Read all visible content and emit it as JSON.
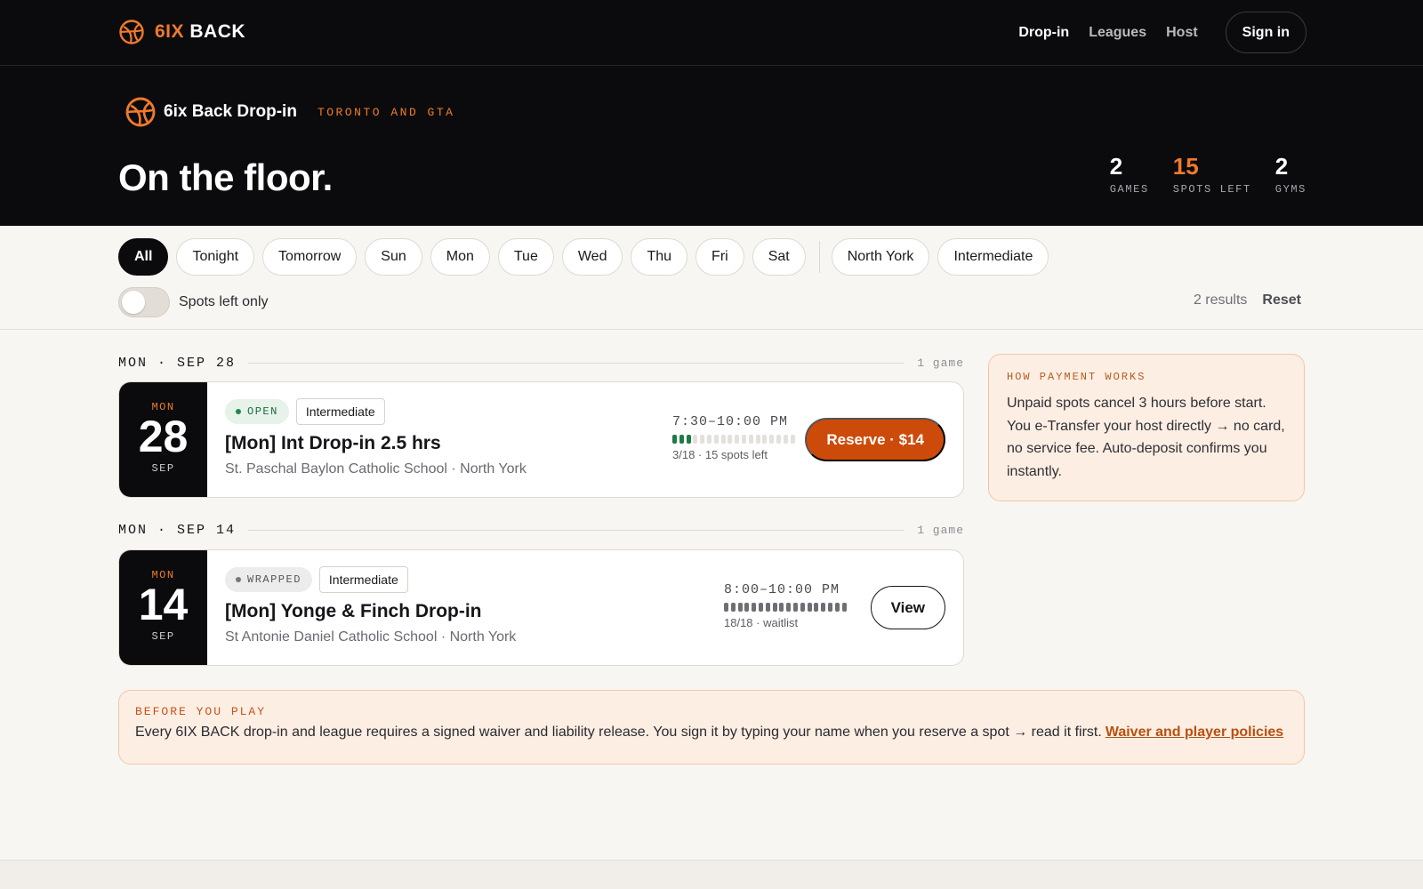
{
  "nav": {
    "brand_6ix": "6IX",
    "brand_back": "BACK",
    "links": [
      "Drop-in",
      "Leagues",
      "Host"
    ],
    "signin_label": "Sign in"
  },
  "hero": {
    "title": "6ix Back Drop-in",
    "region": "TORONTO AND GTA",
    "headline": "On the floor.",
    "stats": [
      {
        "value": "2",
        "label": "GAMES"
      },
      {
        "value": "15",
        "label": "SPOTS LEFT"
      },
      {
        "value": "2",
        "label": "GYMS"
      }
    ]
  },
  "filters": {
    "chips": [
      "All",
      "Tonight",
      "Tomorrow",
      "Sun",
      "Mon",
      "Tue",
      "Wed",
      "Thu",
      "Fri",
      "Sat"
    ],
    "active_chip": "All",
    "extra_chips": [
      "North York",
      "Intermediate"
    ],
    "toggle_label": "Spots left only",
    "toggle_on": false,
    "results_count": "2 results",
    "reset_label": "Reset"
  },
  "days": [
    {
      "label": "MON · SEP 28",
      "count": "1 game",
      "game": {
        "dow": "MON",
        "day": "28",
        "month": "SEP",
        "status": "OPEN",
        "level": "Intermediate",
        "title": "[Mon] Int Drop-in 2.5 hrs",
        "venue": "St. Paschal Baylon Catholic School · North York",
        "time": "7:30–10:00 PM",
        "filled": 3,
        "capacity": 18,
        "capacity_text": "3/18 · 15 spots left",
        "action": "Reserve · $14"
      }
    },
    {
      "label": "MON · SEP 14",
      "count": "1 game",
      "game": {
        "dow": "MON",
        "day": "14",
        "month": "SEP",
        "status": "WRAPPED",
        "level": "Intermediate",
        "title": "[Mon] Yonge & Finch Drop-in",
        "venue": "St Antonie Daniel Catholic School · North York",
        "time": "8:00–10:00 PM",
        "filled": 18,
        "capacity": 18,
        "capacity_text": "18/18 · waitlist",
        "action": "View"
      }
    }
  ],
  "payment": {
    "heading": "HOW PAYMENT WORKS",
    "text": "Unpaid spots cancel 3 hours before start. You e-Transfer your host directly → no card, no service fee. Auto-deposit confirms you instantly."
  },
  "waiver": {
    "heading": "BEFORE YOU PLAY",
    "text": "Every 6IX BACK drop-in and league requires a signed waiver and liability release. You sign it by typing your name when you reserve a spot → read it first.",
    "link": "Waiver and player policies"
  },
  "colors": {
    "accent": "#ef7a2c",
    "reserve": "#cd4b0a",
    "open_green": "#1f7a45",
    "dark": "#0b0b0d"
  }
}
